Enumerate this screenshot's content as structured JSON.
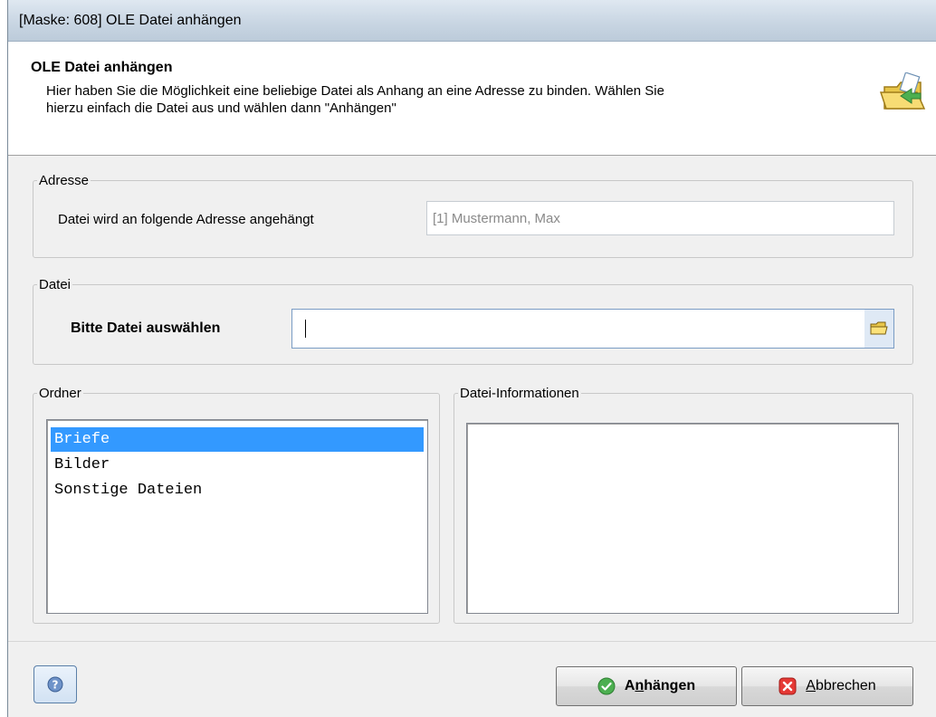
{
  "window": {
    "title": "[Maske: 608] OLE Datei anhängen"
  },
  "header": {
    "title": "OLE Datei anhängen",
    "description_line1": "Hier haben Sie die Möglichkeit eine beliebige Datei als Anhang an eine Adresse zu binden. Wählen Sie",
    "description_line2": "hierzu einfach die Datei aus und wählen dann \"Anhängen\"",
    "icon": "folder-attach-icon"
  },
  "adresse": {
    "legend": "Adresse",
    "label": "Datei wird an folgende Adresse angehängt",
    "value": "[1] Mustermann, Max"
  },
  "datei": {
    "legend": "Datei",
    "label": "Bitte Datei auswählen",
    "value": "",
    "browse_icon": "folder-open-icon"
  },
  "ordner": {
    "legend": "Ordner",
    "items": [
      {
        "label": "Briefe",
        "selected": true
      },
      {
        "label": "Bilder",
        "selected": false
      },
      {
        "label": "Sonstige Dateien",
        "selected": false
      }
    ]
  },
  "datei_info": {
    "legend": "Datei-Informationen"
  },
  "buttons": {
    "help_icon": "help-icon",
    "attach_pre": "A",
    "attach_ul": "n",
    "attach_post": "hängen",
    "cancel_ul": "A",
    "cancel_post": "bbrechen"
  },
  "colors": {
    "selection": "#3399ff",
    "ok_green": "#4caf50",
    "cancel_red": "#e53935"
  }
}
